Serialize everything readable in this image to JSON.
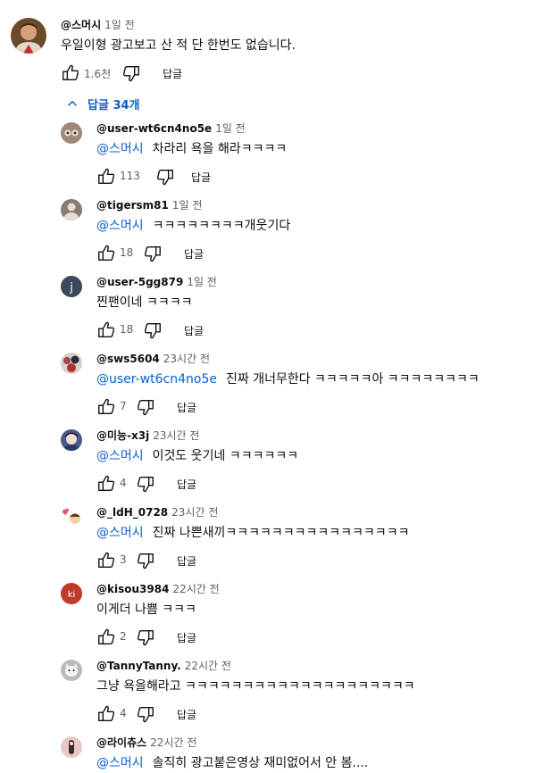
{
  "top_comment": {
    "author": "@스머시",
    "time": "1일 전",
    "text": "우일이형 광고보고 산 적 단 한번도 없습니다.",
    "likes": "1.6천",
    "reply_label": "답글"
  },
  "replies_toggle": {
    "label": "답글 34개"
  },
  "replies": [
    {
      "author": "@user-wt6cn4no5e",
      "time": "1일 전",
      "mention": "@스머시",
      "text": "차라리 욕을 해라ㅋㅋㅋㅋ",
      "likes": "113",
      "reply_label": "답글",
      "avatar_color": "#a08878"
    },
    {
      "author": "@tigersm81",
      "time": "1일 전",
      "mention": "@스머시",
      "text": "ㅋㅋㅋㅋㅋㅋㅋㅋ개웃기다",
      "likes": "18",
      "reply_label": "답글",
      "avatar_color": "#8a7a70"
    },
    {
      "author": "@user-5gg879",
      "time": "1일 전",
      "mention": "",
      "text": "찐팬이네 ㅋㅋㅋㅋ",
      "likes": "18",
      "reply_label": "답글",
      "avatar_color": "#3a4a5a",
      "avatar_letter": "j"
    },
    {
      "author": "@sws5604",
      "time": "23시간 전",
      "mention": "@user-wt6cn4no5e",
      "text": "진짜 개너무한다 ㅋㅋㅋㅋㅋ아 ㅋㅋㅋㅋㅋㅋㅋㅋ",
      "likes": "7",
      "reply_label": "답글",
      "avatar_color": "#9a4a4a"
    },
    {
      "author": "@미능-x3j",
      "time": "23시간 전",
      "mention": "@스머시",
      "text": "이것도 웃기네 ㅋㅋㅋㅋㅋㅋ",
      "likes": "4",
      "reply_label": "답글",
      "avatar_color": "#4a5a8a"
    },
    {
      "author": "@_ldH_0728",
      "time": "23시간 전",
      "mention": "@스머시",
      "text": "진짜 나쁜새끼ㅋㅋㅋㅋㅋㅋㅋㅋㅋㅋㅋㅋㅋㅋㅋㅋ",
      "likes": "3",
      "reply_label": "답글",
      "avatar_color": "#e85a6a"
    },
    {
      "author": "@kisou3984",
      "time": "22시간 전",
      "mention": "",
      "text": "이게더 나쁨 ㅋㅋㅋ",
      "likes": "2",
      "reply_label": "답글",
      "avatar_color": "#c0392b",
      "avatar_letter": "ki"
    },
    {
      "author": "@TannyTanny.",
      "time": "22시간 전",
      "mention": "",
      "text": "그냥 욕을해라고 ㅋㅋㅋㅋㅋㅋㅋㅋㅋㅋㅋㅋㅋㅋㅋㅋㅋㅋㅋㅋ",
      "likes": "4",
      "reply_label": "답글",
      "avatar_color": "#b8bcb8"
    },
    {
      "author": "@라이츄스",
      "time": "22시간 전",
      "mention": "@스머시",
      "text": "솔직히 광고붙은영상 재미없어서 안 봄....",
      "likes": "",
      "reply_label": "",
      "avatar_color": "#e8c8c8"
    }
  ]
}
